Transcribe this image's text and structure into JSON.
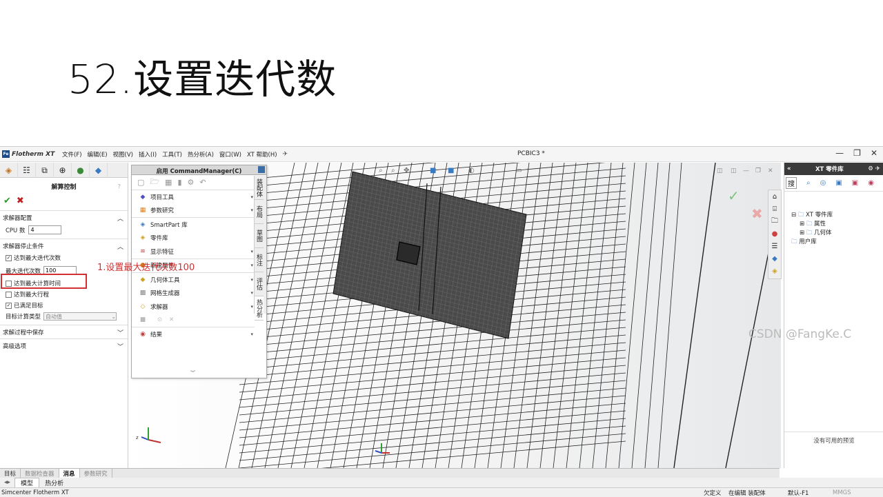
{
  "slide": {
    "title": "52.设置迭代数"
  },
  "app": {
    "logo_box": "Fe",
    "logo_text": "Flotherm XT",
    "menus": [
      "文件(F)",
      "编辑(E)",
      "视图(V)",
      "插入(I)",
      "工具(T)",
      "热分析(A)",
      "窗口(W)",
      "XT 帮助(H)"
    ],
    "doc_title": "PCBIC3 *"
  },
  "solve_panel": {
    "title": "解算控制",
    "help": "?",
    "sections": {
      "config": "求解器配置",
      "cpu_label": "CPU 数",
      "cpu_value": "4",
      "stop": "求解器停止条件",
      "max_iter_checkbox": "达到最大迭代次数",
      "max_iter_label": "最大迭代次数",
      "max_iter_value": "100",
      "max_time": "达到最大计算时间",
      "max_travel": "达到最大行程",
      "goal_met": "已满足目标",
      "goal_type_label": "目标计算类型",
      "goal_type_value": "自动值",
      "save_during": "求解过程中保存",
      "advanced": "高级选项"
    }
  },
  "annotation": "1.设置最大迭代次数100",
  "command_manager": {
    "title": "启用 CommandManager(C)",
    "items": [
      "项目工具",
      "参数研究",
      "SmartPart 库",
      "零件库",
      "显示特征",
      "新建属性",
      "几何体工具",
      "网格生成器",
      "求解器",
      "结果"
    ],
    "vtabs": [
      "装配体",
      "布局",
      "草图",
      "标注",
      "评估",
      "热分析"
    ]
  },
  "bottom_tabs": [
    "目标",
    "数据检查器",
    "消息",
    "参数研究"
  ],
  "bottom_tabs2": [
    "模型",
    "热分析"
  ],
  "status": {
    "app_name": "Simcenter Flotherm XT",
    "under_defined": "欠定义",
    "editing": "在编辑 装配体",
    "units_system": "默认-F1",
    "units": "MMGS"
  },
  "library": {
    "title": "XT 零件库",
    "tree_root": "XT 零件库",
    "tree_children": [
      "属性",
      "几何体"
    ],
    "user_lib": "用户库",
    "no_preview": "没有可用的预览"
  },
  "watermark": "CSDN @FangKe.C"
}
